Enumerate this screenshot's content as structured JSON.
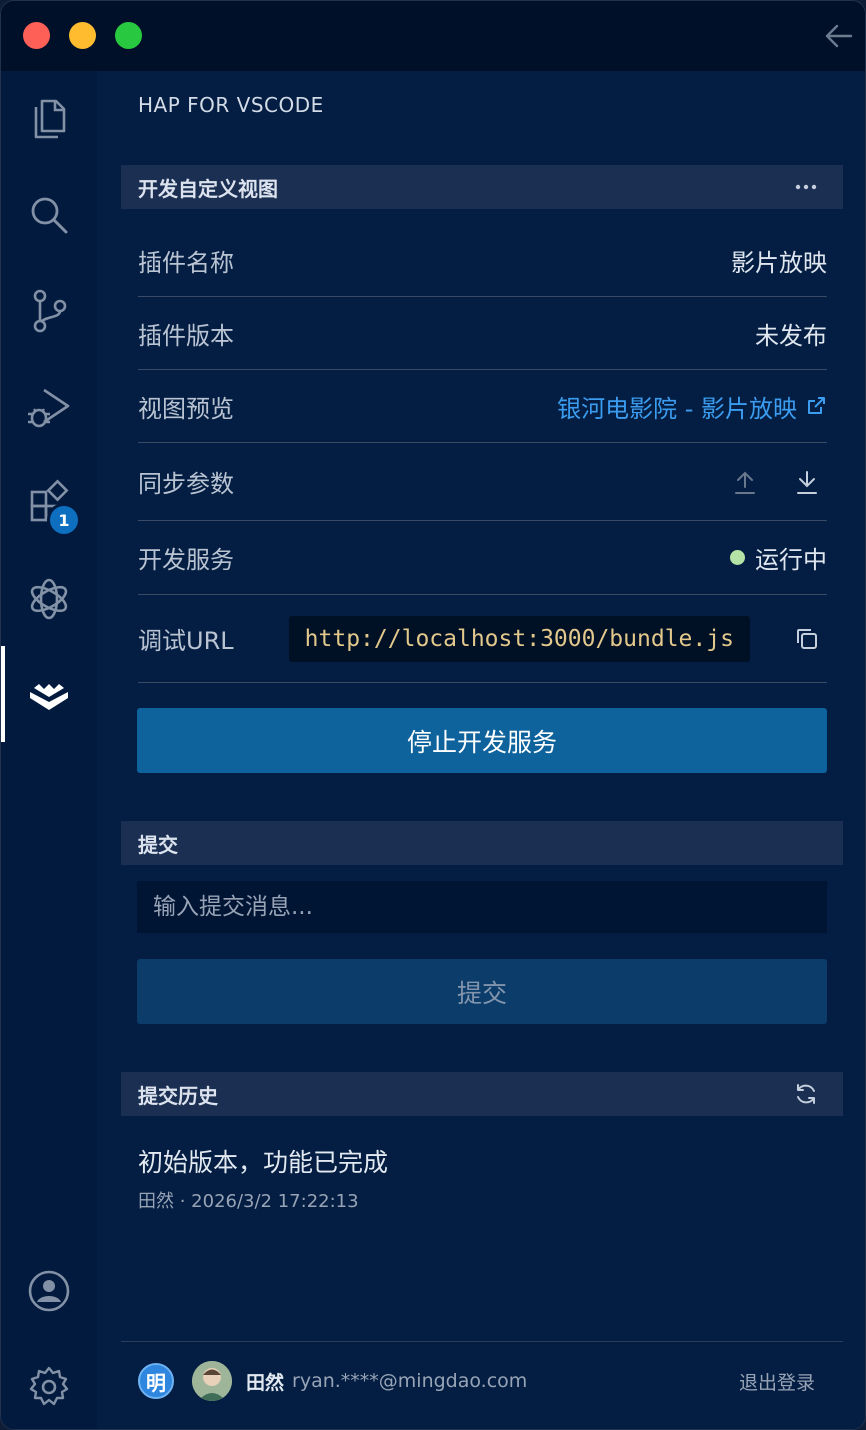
{
  "window": {
    "traffic_lights": [
      "close",
      "minimize",
      "zoom"
    ],
    "back_icon": "arrow-left-icon"
  },
  "activity_bar": {
    "items": [
      {
        "name": "explorer-icon"
      },
      {
        "name": "search-icon"
      },
      {
        "name": "source-control-icon"
      },
      {
        "name": "run-debug-icon"
      },
      {
        "name": "extensions-icon",
        "badge": "1"
      },
      {
        "name": "openai-icon"
      },
      {
        "name": "hap-icon",
        "active": true
      }
    ],
    "bottom": [
      {
        "name": "account-icon"
      },
      {
        "name": "settings-gear-icon"
      }
    ]
  },
  "sidebar": {
    "title": "HAP FOR VSCODE"
  },
  "dev_view": {
    "header": "开发自定义视图",
    "more_icon": "ellipsis-icon",
    "plugin_name_label": "插件名称",
    "plugin_name_value": "影片放映",
    "plugin_version_label": "插件版本",
    "plugin_version_value": "未发布",
    "preview_label": "视图预览",
    "preview_link": "银河电影院 - 影片放映",
    "sync_label": "同步参数",
    "service_label": "开发服务",
    "service_status": "运行中",
    "debug_url_label": "调试URL",
    "debug_url_value": "http://localhost:3000/bundle.js",
    "stop_button": "停止开发服务"
  },
  "commit": {
    "header": "提交",
    "placeholder": "输入提交消息...",
    "button": "提交"
  },
  "history": {
    "header": "提交历史",
    "items": [
      {
        "title": "初始版本，功能已完成",
        "meta": "田然 · 2026/3/2 17:22:13"
      }
    ]
  },
  "footer": {
    "org_badge": "明",
    "user_name": "田然",
    "user_email": "ryan.****@mingdao.com",
    "logout": "退出登录"
  },
  "colors": {
    "accent": "#0e639c",
    "link": "#3b9cf0",
    "status_running": "#b5e3a5",
    "url_text": "#e2c88b"
  }
}
